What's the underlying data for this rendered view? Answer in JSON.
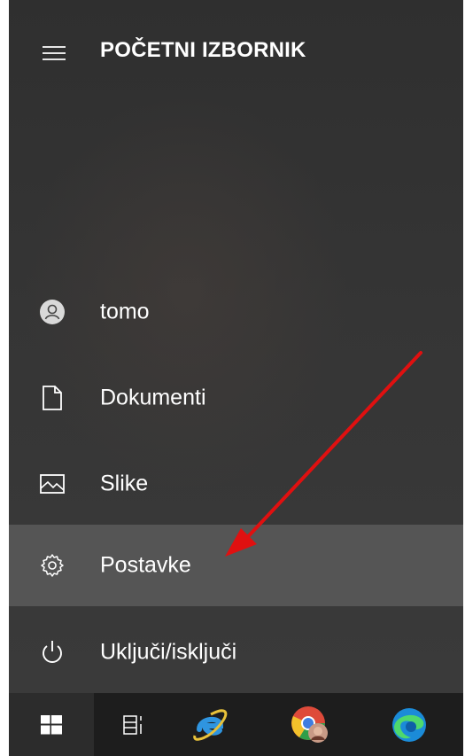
{
  "header": {
    "title": "POČETNI IZBORNIK",
    "menu_icon": "hamburger-icon"
  },
  "menu": {
    "items": [
      {
        "label": "tomo",
        "icon": "user-avatar-icon"
      },
      {
        "label": "Dokumenti",
        "icon": "document-icon"
      },
      {
        "label": "Slike",
        "icon": "pictures-icon"
      },
      {
        "label": "Postavke",
        "icon": "gear-icon",
        "highlighted": true
      },
      {
        "label": "Uključi/isključi",
        "icon": "power-icon"
      }
    ]
  },
  "taskbar": {
    "icons": [
      "windows-start-icon",
      "task-view-icon",
      "internet-explorer-icon",
      "chrome-profile-icon",
      "edge-icon"
    ]
  },
  "annotation": {
    "arrow_color": "#e01010"
  },
  "colors": {
    "menu_background": "#333333",
    "highlight": "#5a5a5a",
    "taskbar": "#1d1d1d"
  }
}
